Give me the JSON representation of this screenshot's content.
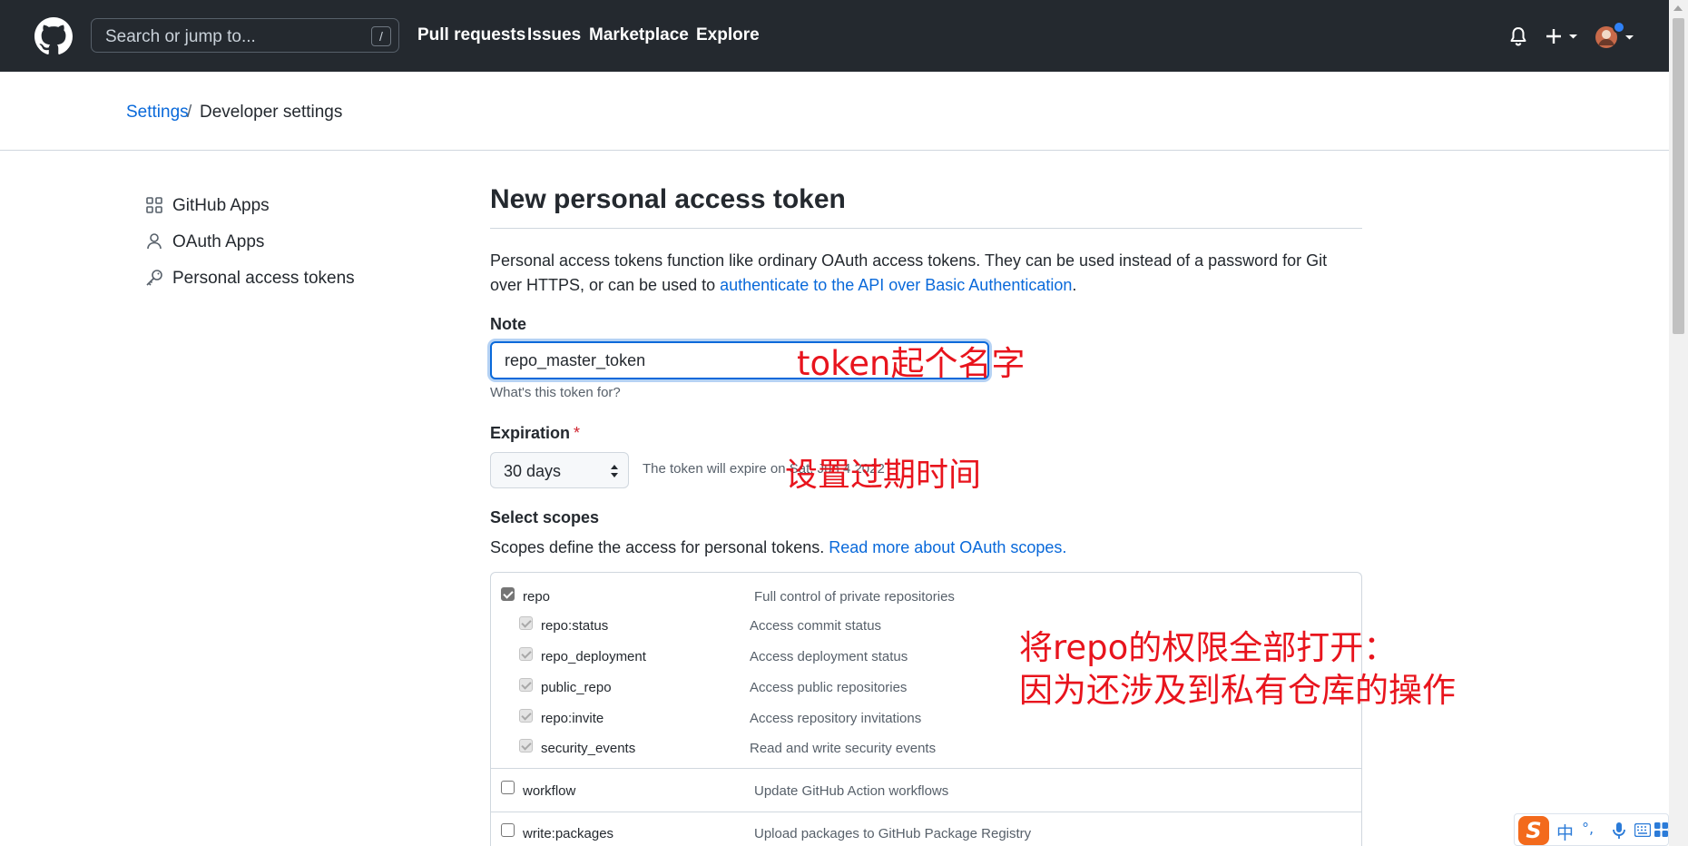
{
  "header": {
    "search_placeholder": "Search or jump to...",
    "search_key": "/",
    "nav": [
      "Pull requests",
      "Issues",
      "Marketplace",
      "Explore"
    ],
    "plus_label": "+"
  },
  "breadcrumb": {
    "settings": "Settings",
    "separator": "/",
    "current": "Developer settings"
  },
  "sidebar": {
    "items": [
      {
        "label": "GitHub Apps",
        "icon": "apps-grid-icon"
      },
      {
        "label": "OAuth Apps",
        "icon": "person-icon"
      },
      {
        "label": "Personal access tokens",
        "icon": "key-icon"
      }
    ]
  },
  "main": {
    "title": "New personal access token",
    "description_prefix": "Personal access tokens function like ordinary OAuth access tokens. They can be used instead of a password for Git over HTTPS, or can be used to ",
    "description_link": "authenticate to the API over Basic Authentication",
    "description_suffix": ".",
    "note_label": "Note",
    "note_value": "repo_master_token",
    "note_hint": "What's this token for?",
    "expiration_label": "Expiration",
    "expiration_required": "*",
    "expiration_value": "30 days",
    "expiration_text": "The token will expire on Sat, Jun 4 2022",
    "scopes_label": "Select scopes",
    "scopes_help": "Scopes define the access for personal tokens. ",
    "scopes_help_link": "Read more about OAuth scopes."
  },
  "scopes": {
    "repo": {
      "name": "repo",
      "desc": "Full control of private repositories",
      "checked": true
    },
    "repo_children": [
      {
        "name": "repo:status",
        "desc": "Access commit status"
      },
      {
        "name": "repo_deployment",
        "desc": "Access deployment status"
      },
      {
        "name": "public_repo",
        "desc": "Access public repositories"
      },
      {
        "name": "repo:invite",
        "desc": "Access repository invitations"
      },
      {
        "name": "security_events",
        "desc": "Read and write security events"
      }
    ],
    "workflow": {
      "name": "workflow",
      "desc": "Update GitHub Action workflows",
      "checked": false
    },
    "write_packages": {
      "name": "write:packages",
      "desc": "Upload packages to GitHub Package Registry",
      "checked": false
    }
  },
  "annotations": {
    "note": "token起个名字",
    "expiration": "设置过期时间",
    "scopes_line1": "将repo的权限全部打开：",
    "scopes_line2": "因为还涉及到私有仓库的操作"
  },
  "ime": {
    "logo": "S",
    "lang": "中",
    "punct": "°,",
    "mic": "mic-icon",
    "keyboard": "keyboard-icon",
    "grid": "grid-icon"
  },
  "colors": {
    "header_bg": "#24292f",
    "link": "#0969da",
    "annotation": "#e8141d",
    "focus": "#0969da"
  }
}
